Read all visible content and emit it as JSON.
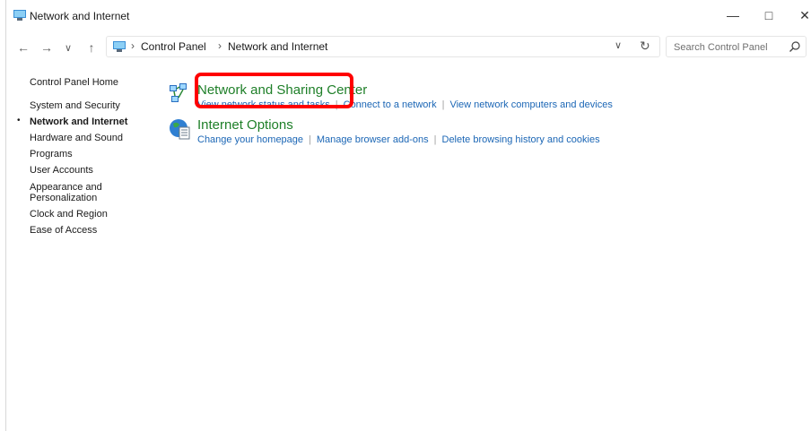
{
  "window": {
    "title": "Network and Internet",
    "minimize": "—",
    "maximize": "□",
    "close": "✕"
  },
  "nav": {
    "back": "←",
    "forward": "→",
    "history": "∨",
    "up": "↑"
  },
  "address": {
    "separator": "›",
    "crumbs": [
      "Control Panel",
      "Network and Internet"
    ],
    "dropdown": "∨",
    "refresh": "↻"
  },
  "search": {
    "placeholder": "Search Control Panel"
  },
  "sidebar": {
    "home": "Control Panel Home",
    "bullet": "•",
    "items": [
      "System and Security",
      "Network and Internet",
      "Hardware and Sound",
      "Programs",
      "User Accounts",
      "Appearance and",
      "Personalization",
      "Clock and Region",
      "Ease of Access"
    ]
  },
  "categories": [
    {
      "title": "Network and Sharing Center",
      "links": [
        "View network status and tasks",
        "Connect to a network",
        "View network computers and devices"
      ]
    },
    {
      "title": "Internet Options",
      "links": [
        "Change your homepage",
        "Manage browser add-ons",
        "Delete browsing history and cookies"
      ]
    }
  ],
  "colors": {
    "category_title": "#1e7f28",
    "link": "#1b66b5",
    "highlight": "#ff0000"
  },
  "icons": {
    "app": "control-panel-icon",
    "network_category": "network-sharing-icon",
    "internet_category": "internet-options-icon",
    "search": "search-icon"
  }
}
